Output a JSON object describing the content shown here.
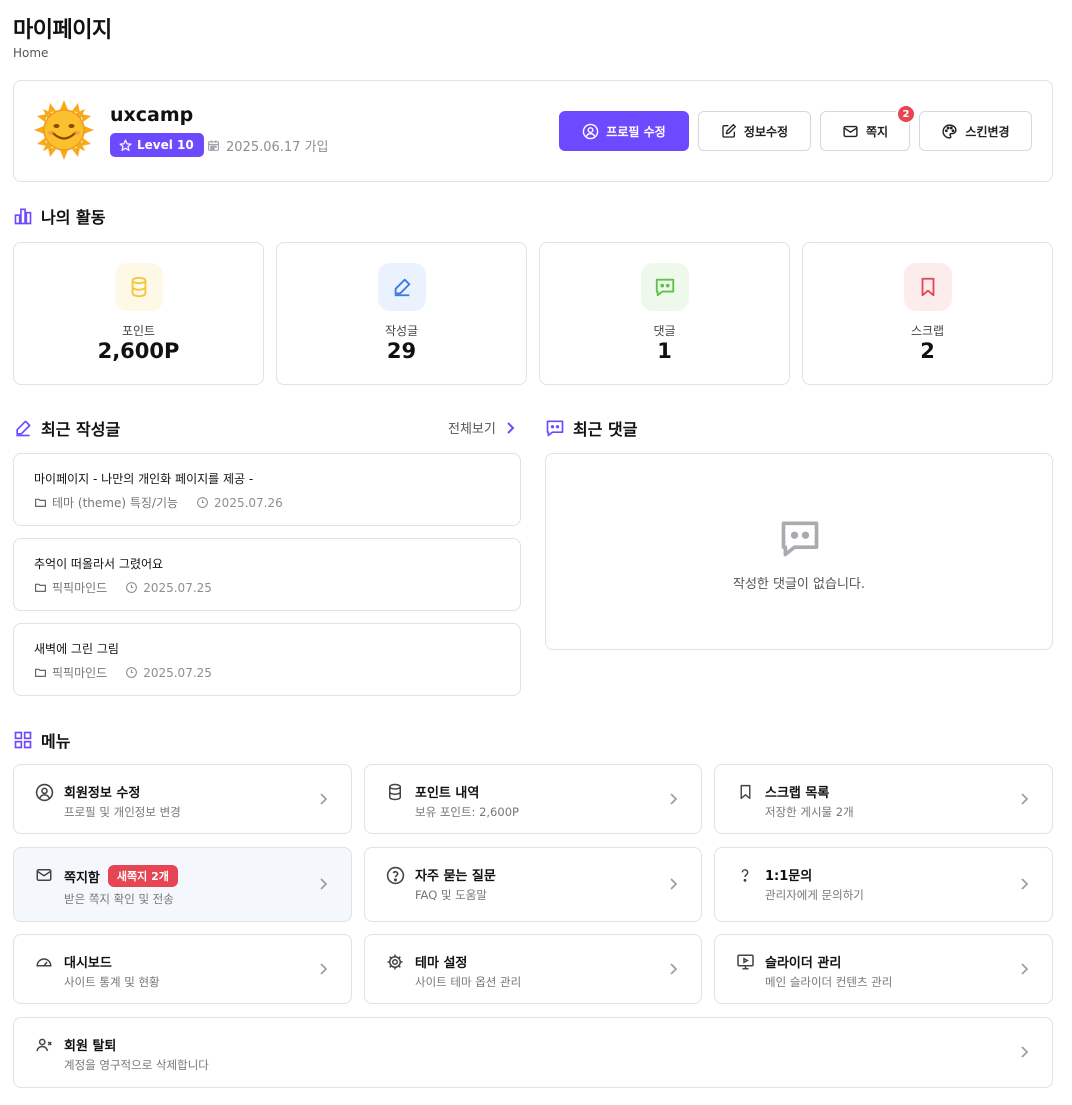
{
  "header": {
    "title": "마이페이지",
    "breadcrumb": "Home"
  },
  "profile": {
    "username": "uxcamp",
    "level": "Level 10",
    "join_date": "2025.06.17 가입",
    "buttons": {
      "edit_profile": "프로필 수정",
      "edit_info": "정보수정",
      "message": "쪽지",
      "message_count": "2",
      "skin": "스킨변경"
    }
  },
  "activity": {
    "title": "나의 활동",
    "stats": [
      {
        "label": "포인트",
        "value": "2,600P",
        "icon": "database-icon",
        "color": "#f5c63b"
      },
      {
        "label": "작성글",
        "value": "29",
        "icon": "pencil-icon",
        "color": "#3d7be0"
      },
      {
        "label": "댓글",
        "value": "1",
        "icon": "message-square-icon",
        "color": "#5cc24a"
      },
      {
        "label": "스크랩",
        "value": "2",
        "icon": "bookmark-icon",
        "color": "#e64553"
      }
    ]
  },
  "recent_posts": {
    "title": "최근 작성글",
    "view_all": "전체보기",
    "posts": [
      {
        "title": "마이페이지 - 나만의 개인화 페이지를 제공 -",
        "category": "테마 (theme) 특징/기능",
        "date": "2025.07.26"
      },
      {
        "title": "추억이 떠올라서 그렸어요",
        "category": "픽픽마인드",
        "date": "2025.07.25"
      },
      {
        "title": "새벽에 그린 그림",
        "category": "픽픽마인드",
        "date": "2025.07.25"
      }
    ]
  },
  "recent_comments": {
    "title": "최근 댓글",
    "empty_text": "작성한 댓글이 없습니다."
  },
  "menu": {
    "title": "메뉴",
    "items": [
      {
        "title": "회원정보 수정",
        "desc": "프로필 및 개인정보 변경",
        "icon": "user-circle-icon"
      },
      {
        "title": "포인트 내역",
        "desc": "보유 포인트: 2,600P",
        "icon": "database-icon"
      },
      {
        "title": "스크랩 목록",
        "desc": "저장한 게시물 2개",
        "icon": "bookmark-icon"
      },
      {
        "title": "쪽지함",
        "badge": "새쪽지 2개",
        "desc": "받은 쪽지 확인 및 전송",
        "icon": "mail-icon"
      },
      {
        "title": "자주 묻는 질문",
        "desc": "FAQ 및 도움말",
        "icon": "help-circle-icon"
      },
      {
        "title": "1:1문의",
        "desc": "관리자에게 문의하기",
        "icon": "question-mark-icon"
      },
      {
        "title": "대시보드",
        "desc": "사이트 통계 및 현황",
        "icon": "gauge-icon"
      },
      {
        "title": "테마 설정",
        "desc": "사이트 테마 옵션 관리",
        "icon": "gear-icon"
      },
      {
        "title": "슬라이더 관리",
        "desc": "메인 슬라이더 컨텐츠 관리",
        "icon": "monitor-play-icon"
      },
      {
        "title": "회원 탈퇴",
        "desc": "계정을 영구적으로 삭제합니다",
        "icon": "user-x-icon"
      }
    ]
  },
  "colors": {
    "accent": "#6d4aff",
    "danger": "#e64553",
    "border": "#dfe2e6"
  }
}
